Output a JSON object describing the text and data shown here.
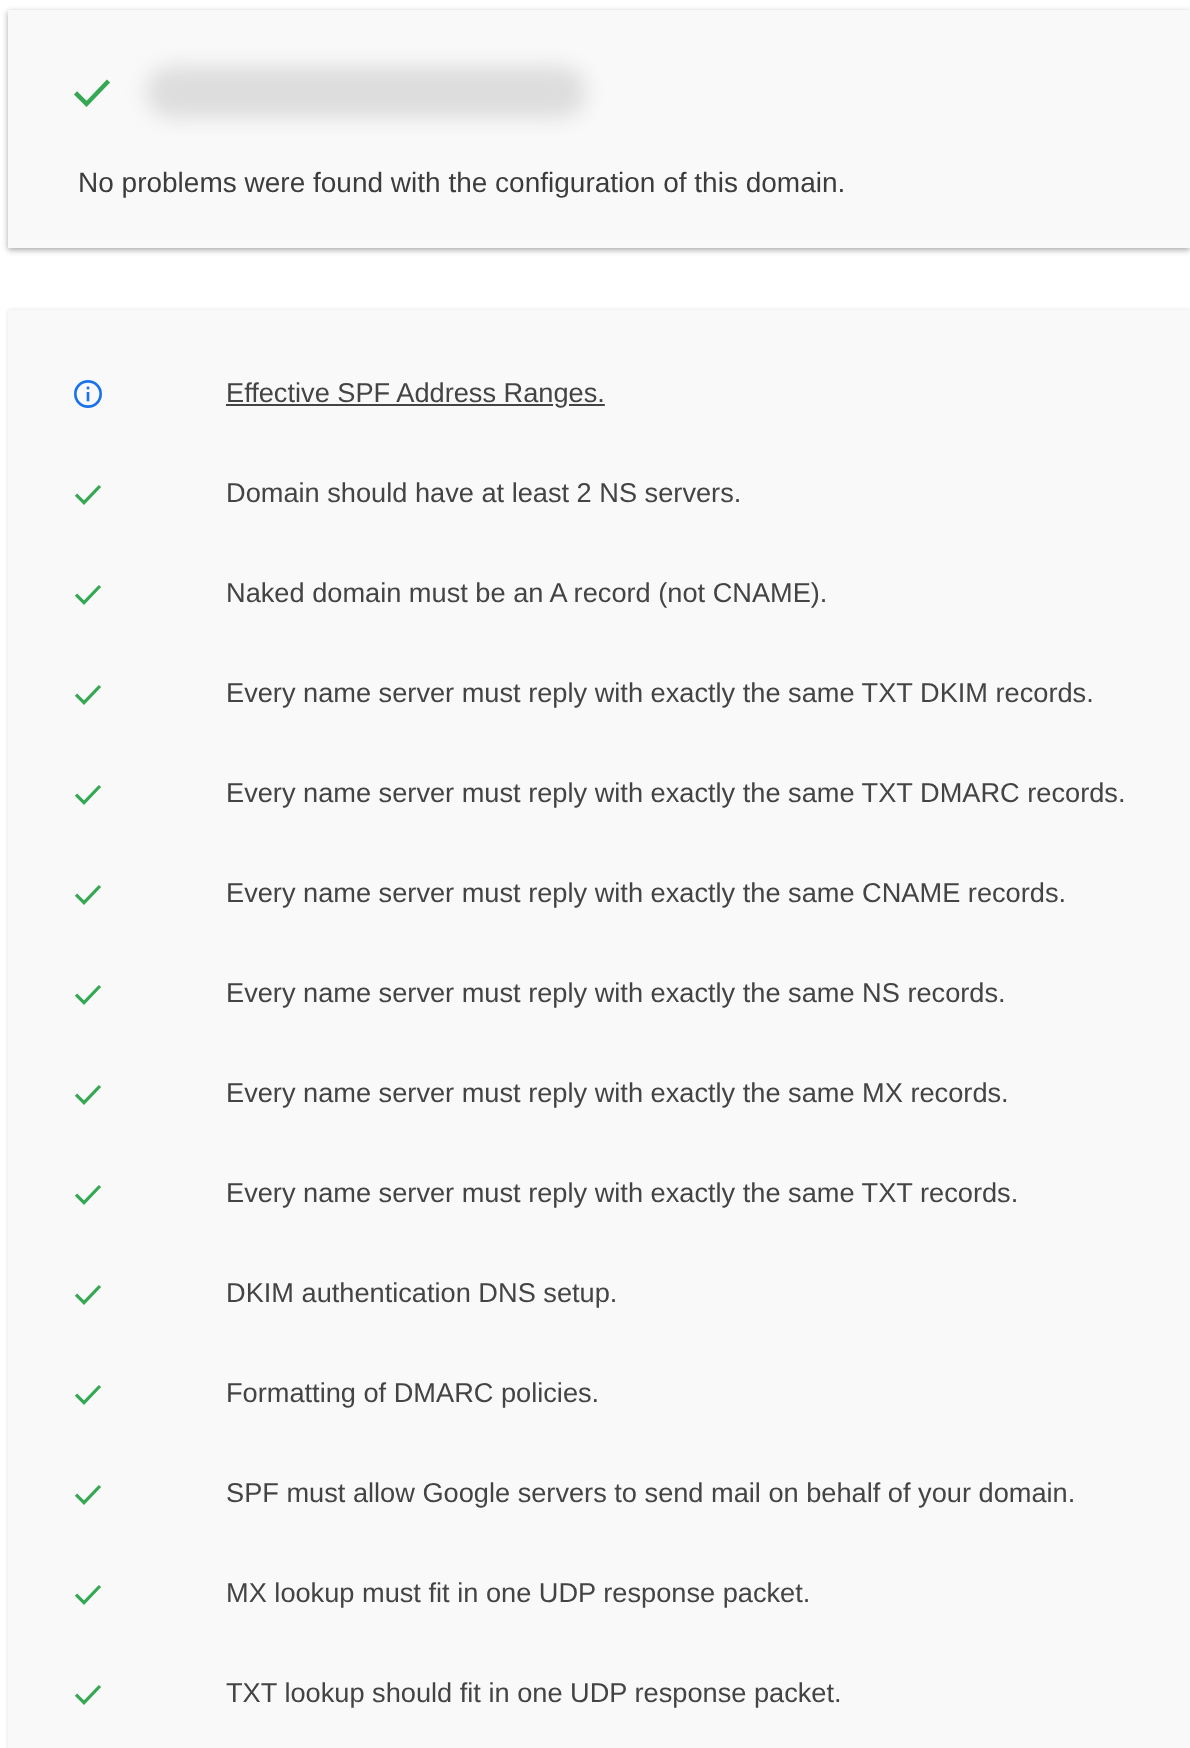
{
  "summary": {
    "kind": "pass",
    "message": "No problems were found with the configuration of this domain."
  },
  "checks": [
    {
      "kind": "info",
      "text": "Effective SPF Address Ranges."
    },
    {
      "kind": "pass",
      "text": "Domain should have at least 2 NS servers."
    },
    {
      "kind": "pass",
      "text": "Naked domain must be an A record (not CNAME)."
    },
    {
      "kind": "pass",
      "text": "Every name server must reply with exactly the same TXT DKIM records."
    },
    {
      "kind": "pass",
      "text": "Every name server must reply with exactly the same TXT DMARC records."
    },
    {
      "kind": "pass",
      "text": "Every name server must reply with exactly the same CNAME records."
    },
    {
      "kind": "pass",
      "text": "Every name server must reply with exactly the same NS records."
    },
    {
      "kind": "pass",
      "text": "Every name server must reply with exactly the same MX records."
    },
    {
      "kind": "pass",
      "text": "Every name server must reply with exactly the same TXT records."
    },
    {
      "kind": "pass",
      "text": "DKIM authentication DNS setup."
    },
    {
      "kind": "pass",
      "text": "Formatting of DMARC policies."
    },
    {
      "kind": "pass",
      "text": "SPF must allow Google servers to send mail on behalf of your domain."
    },
    {
      "kind": "pass",
      "text": "MX lookup must fit in one UDP response packet."
    },
    {
      "kind": "pass",
      "text": "TXT lookup should fit in one UDP response packet."
    }
  ]
}
